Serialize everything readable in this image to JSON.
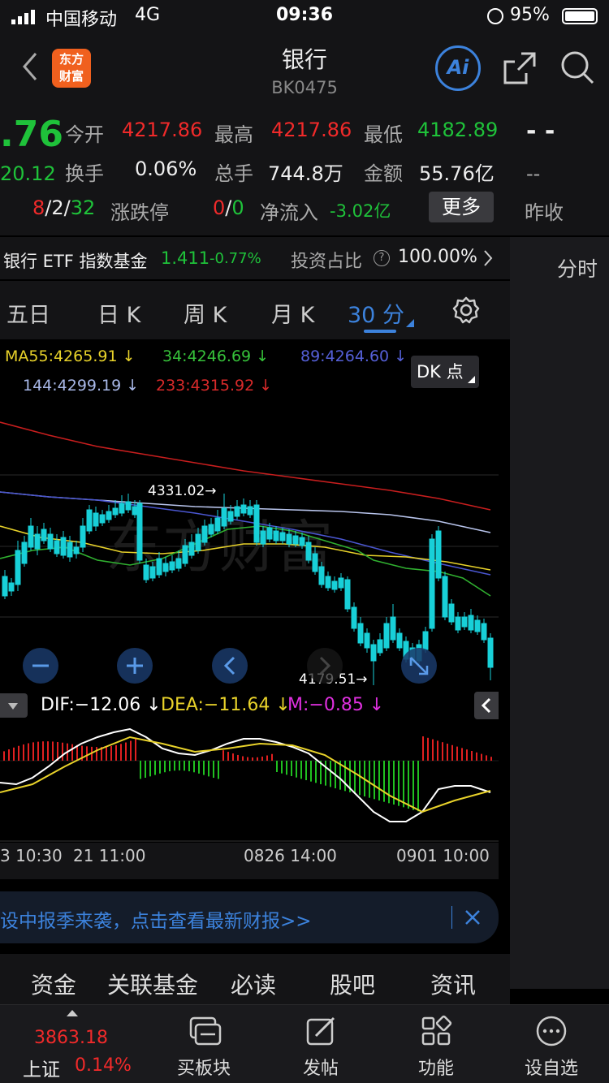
{
  "status_bar": {
    "carrier": "中国移动",
    "network": "4G",
    "time": "09:36",
    "battery": "95%"
  },
  "header": {
    "title": "银行",
    "code": "BK0475",
    "logo_top": "东方",
    "logo_bottom": "财富",
    "ai_label": "Ai"
  },
  "quote": {
    "price": ".76",
    "change": "20.12",
    "open_label": "今开",
    "open_value": "4217.86",
    "high_label": "最高",
    "high_value": "4217.86",
    "low_label": "最低",
    "low_value": "4182.89",
    "turnover_label": "换手",
    "turnover_value": "0.06%",
    "volume_label": "总手",
    "volume_value": "744.8万",
    "amount_label": "金额",
    "amount_value": "55.76亿",
    "updown_red": "8",
    "updown_sep1": "/",
    "updown_flat": "2",
    "updown_sep2": "/",
    "updown_green": "32",
    "limit_label": "涨跌停",
    "limit_red": "0",
    "limit_sep": "/",
    "limit_green": "0",
    "inflow_label": "净流入",
    "inflow_value": "-3.02亿",
    "more_button": "更多",
    "right_dash1": "- -",
    "right_dash2": "--",
    "right_label": "昨收"
  },
  "etf": {
    "name": "银行 ETF 指数基金",
    "price": "1.411",
    "change": "-0.77%",
    "ratio_label": "投资占比",
    "ratio_value": "100.00%"
  },
  "right_tab": "分时",
  "tabs": [
    "五日",
    "日 K",
    "周 K",
    "月 K",
    "30 分"
  ],
  "ma": {
    "ma55": "MA55:4265.91 ↓",
    "ma34": "34:4246.69 ↓",
    "ma89": "89:4264.60 ↓",
    "ma144": "144:4299.19 ↓",
    "ma233": "233:4315.92 ↓",
    "dk_button": "DK 点"
  },
  "chart_labels": {
    "high_mark": "4331.02→",
    "low_mark": "4179.51→"
  },
  "macd": {
    "dif": "DIF:−12.06 ↓",
    "dea": "DEA:−11.64 ↓",
    "m": "M:−0.85 ↓"
  },
  "time_axis": [
    "3 10:30",
    "21 11:00",
    "0826 14:00",
    "0901 10:00"
  ],
  "banner": {
    "text": "设中报季来袭，点击查看最新财报>>"
  },
  "sub_tabs": [
    "资金",
    "关联基金",
    "必读",
    "股吧",
    "资讯"
  ],
  "bottom": {
    "index_value": "3863.18",
    "index_name": "上证",
    "index_change": "0.14%",
    "items": [
      "买板块",
      "发帖",
      "功能",
      "设自选"
    ]
  },
  "colors": {
    "up": "#f02a2a",
    "down": "#1fc23a",
    "accent": "#3c82dc"
  }
}
